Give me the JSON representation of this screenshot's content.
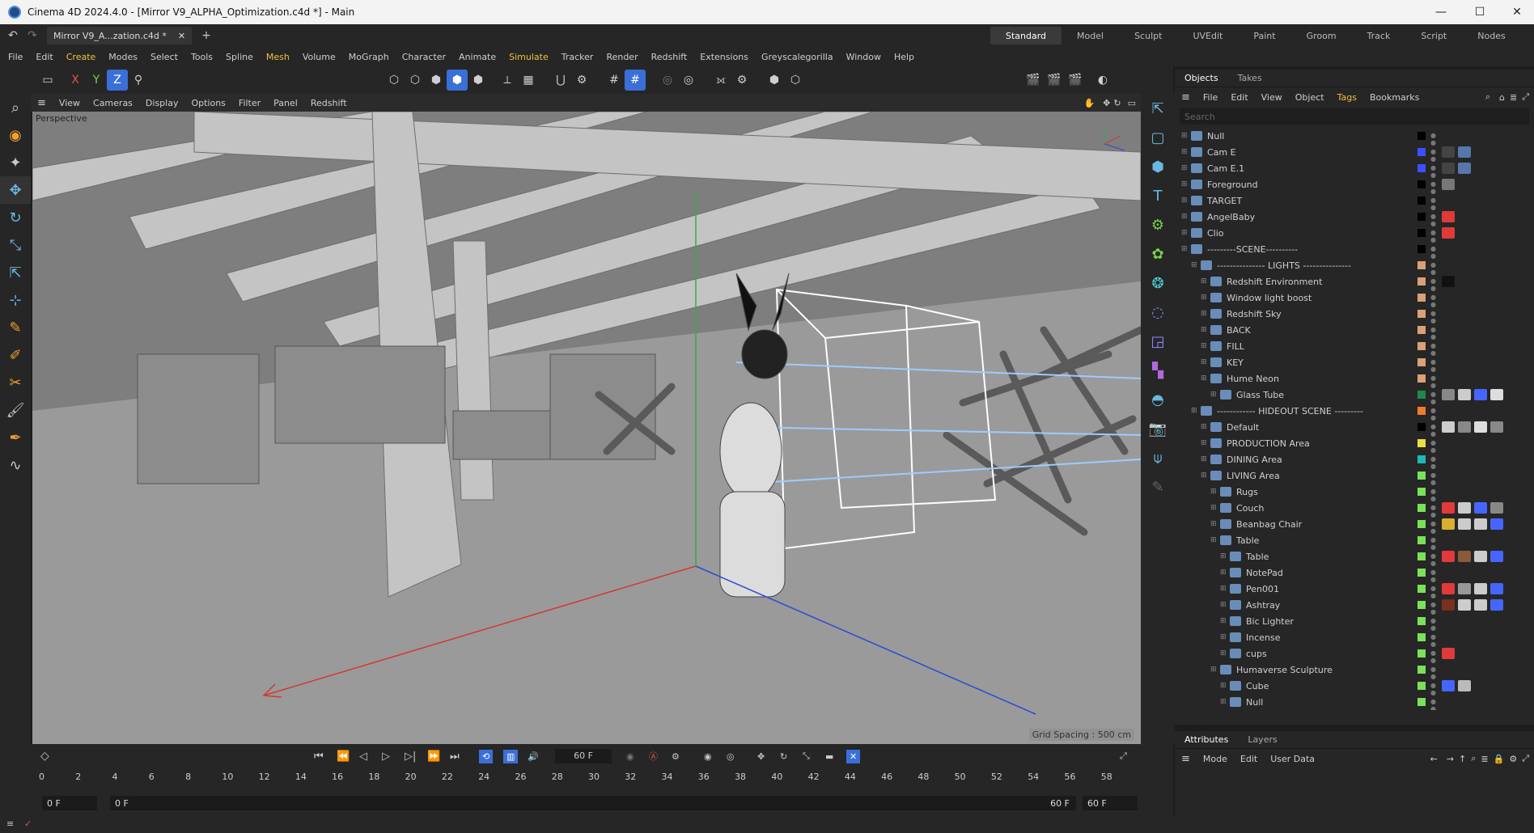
{
  "window": {
    "title": "Cinema 4D 2024.4.0 - [Mirror V9_ALPHA_Optimization.c4d *] - Main",
    "minimize": "—",
    "maximize": "☐",
    "close": "✕"
  },
  "tabs": {
    "doc_tab": "Mirror V9_A...zation.c4d *",
    "close": "✕",
    "add": "+"
  },
  "layouts": [
    "Standard",
    "Model",
    "Sculpt",
    "UVEdit",
    "Paint",
    "Groom",
    "Track",
    "Script",
    "Nodes"
  ],
  "menu": [
    "File",
    "Edit",
    "Create",
    "Modes",
    "Select",
    "Tools",
    "Spline",
    "Mesh",
    "Volume",
    "MoGraph",
    "Character",
    "Animate",
    "Simulate",
    "Tracker",
    "Render",
    "Redshift",
    "Extensions",
    "Greyscalegorilla",
    "Window",
    "Help"
  ],
  "axes": {
    "x": "X",
    "y": "Y",
    "z": "Z"
  },
  "viewport_menu": [
    "View",
    "Cameras",
    "Display",
    "Options",
    "Filter",
    "Panel",
    "Redshift"
  ],
  "viewport": {
    "label": "Perspective",
    "grid_spacing": "Grid Spacing : 500 cm"
  },
  "objects_panel": {
    "tabs": [
      "Objects",
      "Takes"
    ],
    "menu": [
      "File",
      "Edit",
      "View",
      "Object",
      "Tags",
      "Bookmarks"
    ],
    "search_placeholder": "Search",
    "items": [
      {
        "name": "Null",
        "indent": 0,
        "layer": "#000000",
        "tags": []
      },
      {
        "name": "Cam E",
        "indent": 0,
        "layer": "#3d50ff",
        "tags": [
          "#444",
          "#5577aa"
        ]
      },
      {
        "name": "Cam E.1",
        "indent": 0,
        "layer": "#3d50ff",
        "tags": [
          "#444",
          "#5577aa"
        ]
      },
      {
        "name": "Foreground",
        "indent": 0,
        "layer": "#000000",
        "tags": [
          "#777"
        ]
      },
      {
        "name": "TARGET",
        "indent": 0,
        "layer": "#000000",
        "tags": []
      },
      {
        "name": "AngelBaby",
        "indent": 0,
        "layer": "#000000",
        "tags": [
          "#e03a3a"
        ]
      },
      {
        "name": "Clio",
        "indent": 0,
        "layer": "#000000",
        "tags": [
          "#e03a3a"
        ]
      },
      {
        "name": "---------SCENE----------",
        "indent": 0,
        "layer": "#000000",
        "tags": []
      },
      {
        "name": "--------------- LIGHTS ---------------",
        "indent": 1,
        "layer": "#d9a07a",
        "tags": []
      },
      {
        "name": "Redshift Environment",
        "indent": 2,
        "layer": "#d9a07a",
        "tags": [
          "#111"
        ]
      },
      {
        "name": "Window light boost",
        "indent": 2,
        "layer": "#d9a07a",
        "tags": []
      },
      {
        "name": "Redshift Sky",
        "indent": 2,
        "layer": "#d9a07a",
        "tags": []
      },
      {
        "name": "BACK",
        "indent": 2,
        "layer": "#d9a07a",
        "tags": []
      },
      {
        "name": "FILL",
        "indent": 2,
        "layer": "#d9a07a",
        "tags": []
      },
      {
        "name": "KEY",
        "indent": 2,
        "layer": "#d9a07a",
        "tags": []
      },
      {
        "name": "Hume Neon",
        "indent": 2,
        "layer": "#d9a07a",
        "tags": []
      },
      {
        "name": "Glass Tube",
        "indent": 3,
        "layer": "#1d8a4a",
        "tags": [
          "#888",
          "#ccc",
          "#4466ff",
          "#ddd"
        ]
      },
      {
        "name": "------------ HIDEOUT SCENE ---------",
        "indent": 1,
        "layer": "#f07b2e",
        "tags": []
      },
      {
        "name": "Default",
        "indent": 2,
        "layer": "#000000",
        "tags": [
          "#ccc",
          "#888",
          "#ddd",
          "#888"
        ]
      },
      {
        "name": "PRODUCTION Area",
        "indent": 2,
        "layer": "#e8e040",
        "tags": []
      },
      {
        "name": "DINING Area",
        "indent": 2,
        "layer": "#20b8b8",
        "tags": []
      },
      {
        "name": "LIVING Area",
        "indent": 2,
        "layer": "#7be05a",
        "tags": []
      },
      {
        "name": "Rugs",
        "indent": 3,
        "layer": "#7be05a",
        "tags": []
      },
      {
        "name": "Couch",
        "indent": 3,
        "layer": "#7be05a",
        "tags": [
          "#e03a3a",
          "#ccc",
          "#4466ff",
          "#888"
        ]
      },
      {
        "name": "Beanbag Chair",
        "indent": 3,
        "layer": "#7be05a",
        "tags": [
          "#d8b030",
          "#ccc",
          "#ccc",
          "#4466ff"
        ]
      },
      {
        "name": "Table",
        "indent": 3,
        "layer": "#7be05a",
        "tags": []
      },
      {
        "name": "Table",
        "indent": 4,
        "layer": "#7be05a",
        "tags": [
          "#e03a3a",
          "#8a5a3a",
          "#ccc",
          "#4466ff"
        ]
      },
      {
        "name": "NotePad",
        "indent": 4,
        "layer": "#7be05a",
        "tags": []
      },
      {
        "name": "Pen001",
        "indent": 4,
        "layer": "#7be05a",
        "tags": [
          "#e03a3a",
          "#999",
          "#ccc",
          "#4466ff"
        ]
      },
      {
        "name": "Ashtray",
        "indent": 4,
        "layer": "#7be05a",
        "tags": [
          "#7a3020",
          "#ccc",
          "#ccc",
          "#4466ff"
        ]
      },
      {
        "name": "Bic Lighter",
        "indent": 4,
        "layer": "#7be05a",
        "tags": []
      },
      {
        "name": "Incense",
        "indent": 4,
        "layer": "#7be05a",
        "tags": []
      },
      {
        "name": "cups",
        "indent": 4,
        "layer": "#7be05a",
        "tags": [
          "#e03a3a"
        ]
      },
      {
        "name": "Humaverse Sculpture",
        "indent": 3,
        "layer": "#7be05a",
        "tags": []
      },
      {
        "name": "Cube",
        "indent": 4,
        "layer": "#7be05a",
        "tags": [
          "#4466ff",
          "#bbb"
        ]
      },
      {
        "name": "Null",
        "indent": 4,
        "layer": "#7be05a",
        "tags": []
      }
    ]
  },
  "attributes_panel": {
    "tabs": [
      "Attributes",
      "Layers"
    ],
    "menu": [
      "Mode",
      "Edit",
      "User Data"
    ]
  },
  "timeline": {
    "current_frame": "60 F",
    "ticks": [
      "0",
      "2",
      "4",
      "6",
      "8",
      "10",
      "12",
      "14",
      "16",
      "18",
      "20",
      "22",
      "24",
      "26",
      "28",
      "30",
      "32",
      "34",
      "36",
      "38",
      "40",
      "42",
      "44",
      "46",
      "48",
      "50",
      "52",
      "54",
      "56",
      "58"
    ],
    "start": "0 F",
    "min": "0 F",
    "max": "60 F",
    "end": "60 F"
  }
}
